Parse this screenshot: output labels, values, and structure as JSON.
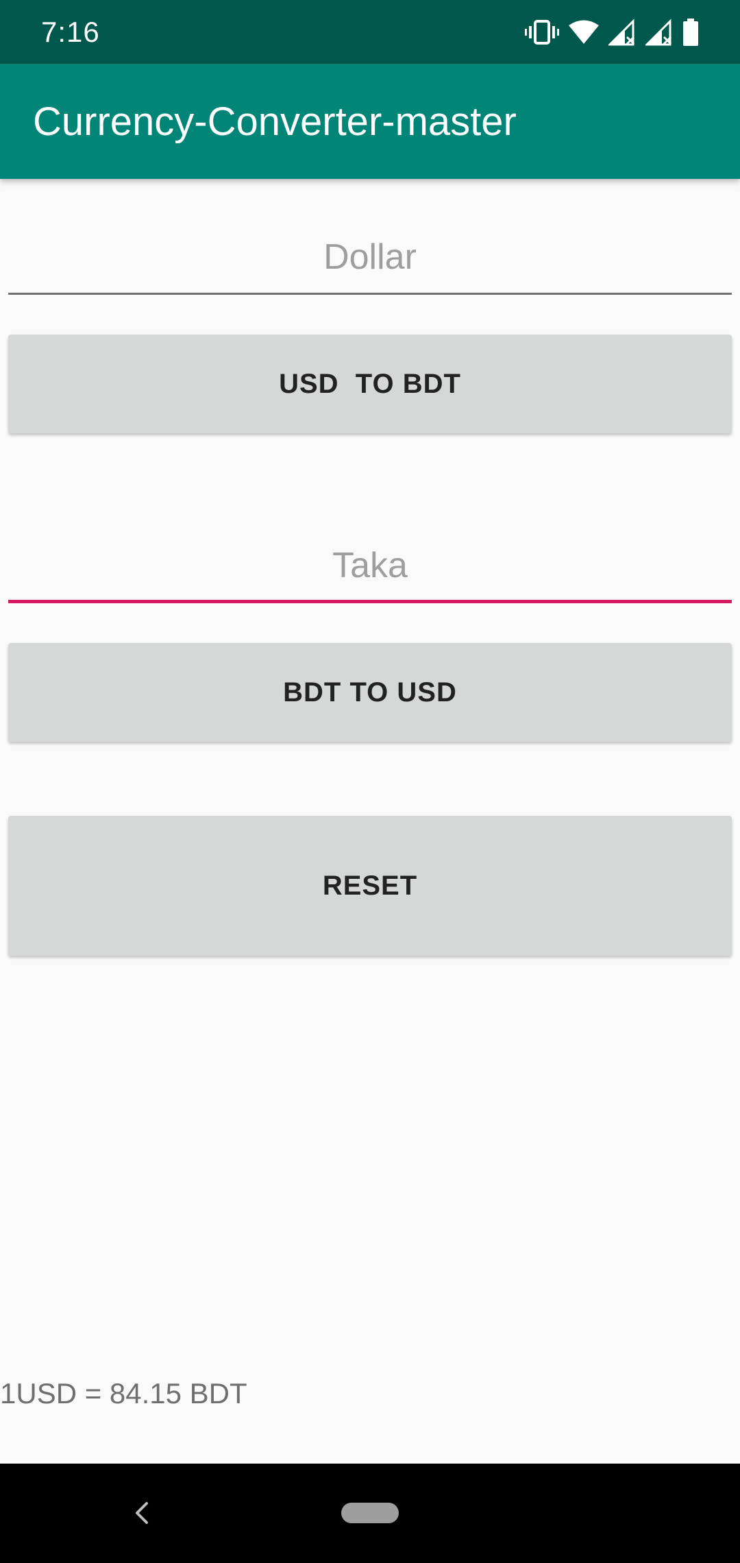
{
  "status_bar": {
    "time": "7:16",
    "icons": [
      "vibrate-icon",
      "wifi-icon",
      "signal-icon",
      "signal-icon",
      "battery-icon"
    ]
  },
  "app_bar": {
    "title": "Currency-Converter-master",
    "background": "#008577"
  },
  "main": {
    "dollar_field": {
      "placeholder": "Dollar",
      "value": ""
    },
    "usd_to_bdt_button": "USD  TO BDT",
    "taka_field": {
      "placeholder": "Taka",
      "value": "",
      "focused": true,
      "accent_color": "#d81b60"
    },
    "bdt_to_usd_button": "BDT TO USD",
    "reset_button": "RESET",
    "rate_text": "1USD = 84.15 BDT"
  },
  "nav_bar": {
    "icons": [
      "back-icon",
      "home-pill-icon"
    ]
  }
}
